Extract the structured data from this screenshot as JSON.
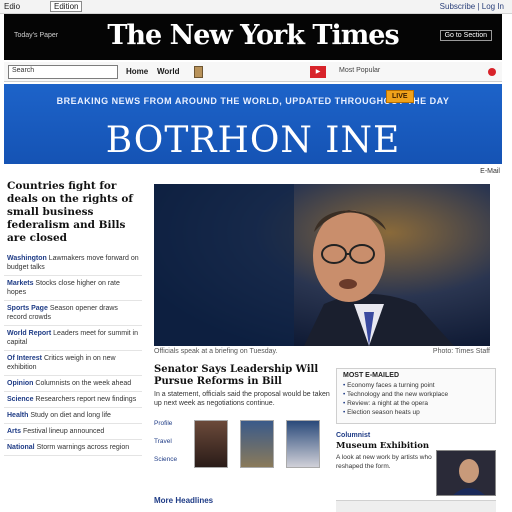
{
  "topbar": {
    "left": "Edio",
    "tab": "Edition",
    "right": "Subscribe | Log In"
  },
  "masthead": {
    "logo": "The New York Times",
    "date": "Today's Paper",
    "button": "Go to Section"
  },
  "nav": {
    "search_placeholder": "Search",
    "link_a": "Home",
    "link_b": "World",
    "play_label": "Video",
    "link_c": "Most Popular"
  },
  "banner": {
    "subtitle": "BREAKING NEWS FROM AROUND THE WORLD, UPDATED THROUGHOUT THE DAY",
    "title": "BOTRHON INE",
    "badge": "LIVE"
  },
  "left": {
    "headline": "Countries fight for deals on the rights of small business federalism and Bills are closed",
    "items": [
      {
        "k": "Washington",
        "d": "Lawmakers move forward on budget talks"
      },
      {
        "k": "Markets",
        "d": "Stocks close higher on rate hopes"
      },
      {
        "k": "Sports Page",
        "d": "Season opener draws record crowds"
      },
      {
        "k": "World Report",
        "d": "Leaders meet for summit in capital"
      },
      {
        "k": "Of Interest",
        "d": "Critics weigh in on new exhibition"
      },
      {
        "k": "Opinion",
        "d": "Columnists on the week ahead"
      },
      {
        "k": "Science",
        "d": "Researchers report new findings"
      },
      {
        "k": "Health",
        "d": "Study on diet and long life"
      },
      {
        "k": "Arts",
        "d": "Festival lineup announced"
      },
      {
        "k": "National",
        "d": "Storm warnings across region"
      }
    ]
  },
  "topright": "E-Mail",
  "caption": {
    "text": "Officials speak at a briefing on Tuesday.",
    "credit": "Photo: Times Staff"
  },
  "story": {
    "headline": "Senator Says Leadership Will Pursue Reforms in Bill",
    "body": "In a statement, officials said the proposal would be taken up next week as negotiations continue."
  },
  "thumbs": [
    {
      "label": "Profile"
    },
    {
      "label": "Travel"
    },
    {
      "label": "Science"
    }
  ],
  "more": "More Headlines",
  "rightbox": {
    "title": "MOST E-MAILED",
    "items": [
      "Economy faces a turning point",
      "Technology and the new workplace",
      "Review: a night at the opera",
      "Election season heats up"
    ]
  },
  "rightstory": {
    "kicker": "Columnist",
    "headline": "Museum Exhibition",
    "body": "A look at new work by artists who reshaped the form."
  },
  "colors": {
    "masthead": "#050505",
    "banner": "#1d63c9",
    "accent_red": "#d8232a",
    "link": "#1f3c86",
    "badge": "#f0a21b"
  }
}
